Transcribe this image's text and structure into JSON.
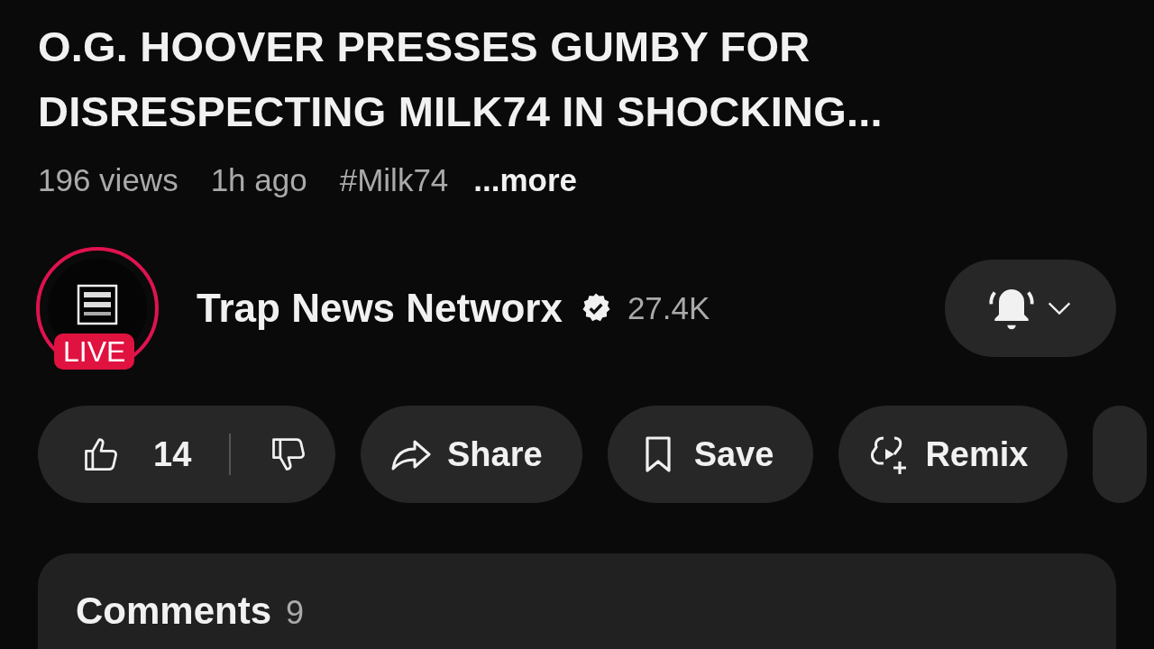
{
  "video": {
    "title": "O.G. HOOVER PRESSES GUMBY FOR DISRESPECTING MILK74 IN SHOCKING...",
    "views": "196 views",
    "age": "1h ago",
    "hashtag": "#Milk74",
    "more": "...more"
  },
  "channel": {
    "live_badge": "LIVE",
    "name": "Trap News Networx",
    "verified": true,
    "subscribers": "27.4K",
    "notifications_on": true
  },
  "actions": [
    {
      "kind": "rating",
      "likes": "14"
    },
    {
      "kind": "share",
      "label": "Share"
    },
    {
      "kind": "save",
      "label": "Save"
    },
    {
      "kind": "remix",
      "label": "Remix"
    }
  ],
  "comments": {
    "title": "Comments",
    "count": "9"
  }
}
